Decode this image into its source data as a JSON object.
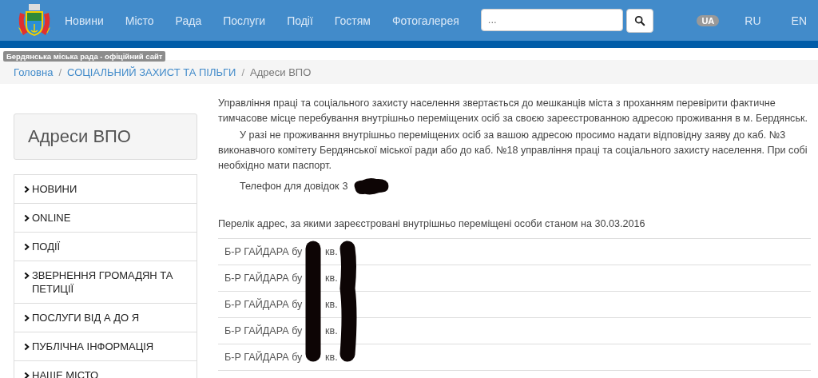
{
  "header": {
    "nav": [
      "Новини",
      "Місто",
      "Рада",
      "Послуги",
      "Події",
      "Гостям",
      "Фотогалерея"
    ],
    "search": {
      "placeholder": "..."
    },
    "languages": [
      {
        "label": "UA",
        "selected": true
      },
      {
        "label": "RU",
        "selected": false
      },
      {
        "label": "EN",
        "selected": false
      }
    ]
  },
  "site_badge": "Бердянська міська рада - офіційний сайт",
  "breadcrumb_separator": "/",
  "breadcrumbs": [
    {
      "label": "Головна",
      "link": true
    },
    {
      "label": "СОЦІАЛЬНИЙ ЗАХИСТ ТА ПІЛЬГИ",
      "link": true
    },
    {
      "label": "Адреси ВПО",
      "link": false
    }
  ],
  "sidebar": {
    "title": "Адреси ВПО",
    "items": [
      "НОВИНИ",
      "ONLINE",
      "ПОДІЇ",
      "ЗВЕРНЕННЯ ГРОМАДЯН ТА ПЕТИЦІЇ",
      "ПОСЛУГИ ВІД А ДО Я",
      "ПУБЛІЧНА ІНФОРМАЦІЯ",
      "НАШЕ МІСТО"
    ]
  },
  "content": {
    "paragraphs": [
      "Управління праці та соціального захисту населення звертається до мешканців міста з проханням перевірити фактичне тимчасове місце перебування внутрішньо переміщених осіб за своєю зареєстрованною адресою проживання в м. Бердянськ.",
      "У разі не проживання внутрішньо переміщених осіб за вашою адресою просимо надати відповідну заяву до каб. №3 виконавчого комітету Бердянської міської ради або до каб. №18 управління праці та соціального захисту населення. При собі необхідно мати паспорт."
    ],
    "phone_label": "Телефон для довідок",
    "phone_value": "3",
    "list_title": "Перелік адрес, за якими зареєстровані внутрішньо переміщені особи станом на 30.03.2016",
    "rows": [
      {
        "street": "Б-Р ГАЙДАРА бу",
        "apartment": "кв."
      },
      {
        "street": "Б-Р ГАЙДАРА бу",
        "apartment": "кв."
      },
      {
        "street": "Б-Р ГАЙДАРА бу",
        "apartment": "кв."
      },
      {
        "street": "Б-Р ГАЙДАРА бу",
        "apartment": "кв."
      },
      {
        "street": "Б-Р ГАЙДАРА бу",
        "apartment": "кв."
      }
    ]
  }
}
